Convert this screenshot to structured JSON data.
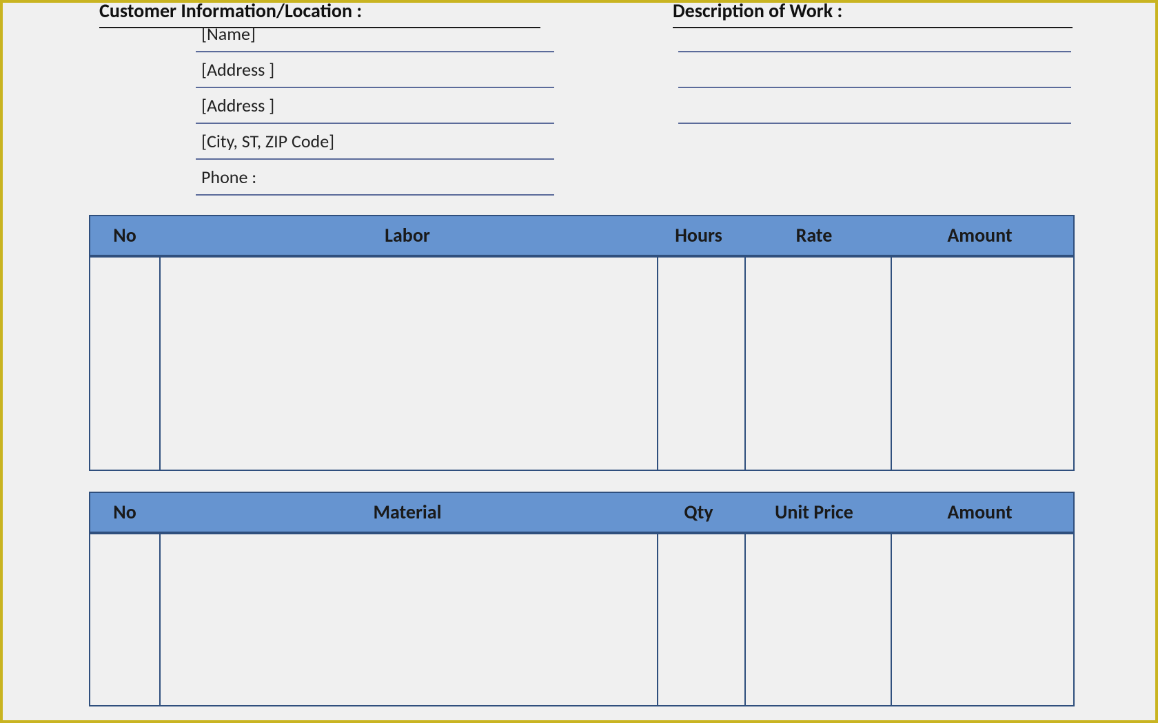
{
  "header": {
    "customer_info_title": "Customer Information/Location :",
    "description_title": "Description of Work :"
  },
  "customer_fields": {
    "name": "[Name]",
    "address1": "[Address ]",
    "address2": "[Address ]",
    "city_state_zip": "[City, ST, ZIP Code]",
    "phone_label": "Phone     :"
  },
  "labor_table": {
    "columns": {
      "no": "No",
      "labor": "Labor",
      "hours": "Hours",
      "rate": "Rate",
      "amount": "Amount"
    }
  },
  "material_table": {
    "columns": {
      "no": "No",
      "material": "Material",
      "qty": "Qty",
      "unit_price": "Unit Price",
      "amount": "Amount"
    }
  }
}
